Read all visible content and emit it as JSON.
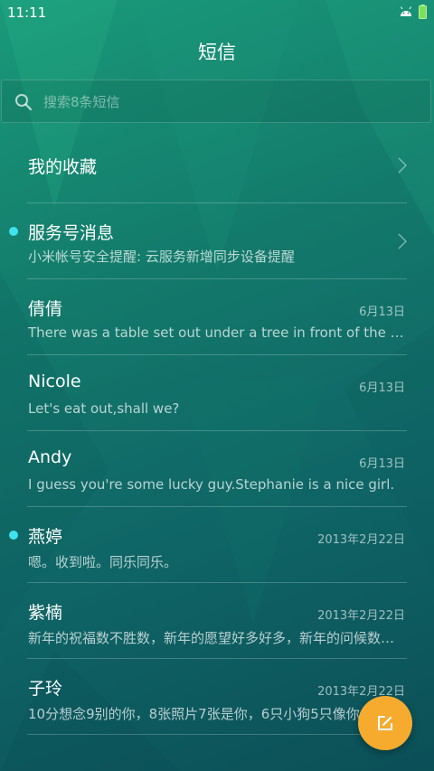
{
  "status_bar": {
    "time": "11:11",
    "icons": [
      "android-icon",
      "battery-icon"
    ]
  },
  "header": {
    "title": "短信"
  },
  "search": {
    "placeholder": "搜索8条短信"
  },
  "favorites": {
    "label": "我的收藏"
  },
  "conversations": [
    {
      "name": "服务号消息",
      "preview": "小米帐号安全提醒: 云服务新增同步设备提醒",
      "date": "",
      "unread": true,
      "chevron": true
    },
    {
      "name": "倩倩",
      "preview": "There was a table set out under a tree in front of the house, and the March Hare and the Hatter were having tea at it",
      "date": "6月13日",
      "unread": false,
      "chevron": false
    },
    {
      "name": "Nicole",
      "preview": "Let's eat out,shall we?",
      "date": "6月13日",
      "unread": false,
      "chevron": false
    },
    {
      "name": "Andy",
      "preview": "I guess you're some lucky guy.Stephanie is a nice girl.",
      "date": "6月13日",
      "unread": false,
      "chevron": false
    },
    {
      "name": "燕婷",
      "preview": "嗯。收到啦。同乐同乐。",
      "date": "2013年2月22日",
      "unread": true,
      "chevron": false
    },
    {
      "name": "紫楠",
      "preview": "新年的祝福数不胜数，新年的愿望好多好多，新年的问候数不胜数",
      "date": "2013年2月22日",
      "unread": false,
      "chevron": false
    },
    {
      "name": "子玲",
      "preview": "10分想念9别的你，8张照片7张是你，6只小狗5只像你",
      "date": "2013年2月22日",
      "unread": false,
      "chevron": false
    }
  ],
  "fab": {
    "icon": "compose-icon"
  },
  "colors": {
    "accent": "#f6ab2f",
    "unread_dot": "#3ee3ee",
    "background_top": "#1a9a7a",
    "background_bottom": "#0b4f57"
  }
}
